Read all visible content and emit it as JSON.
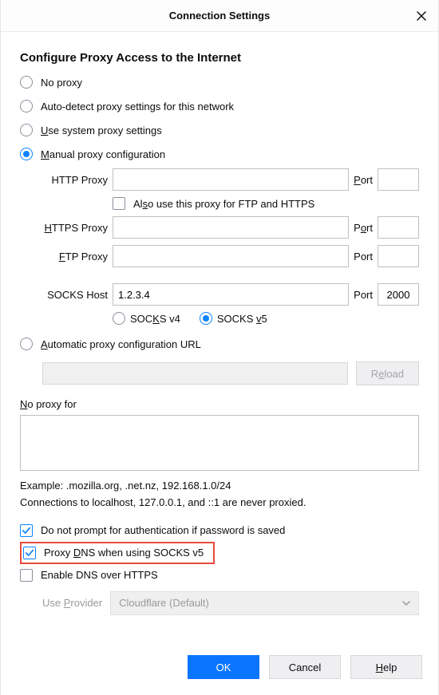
{
  "window": {
    "title": "Connection Settings"
  },
  "section_title": "Configure Proxy Access to the Internet",
  "proxy_mode": {
    "none": "No proxy",
    "auto_detect": "Auto-detect proxy settings for this network",
    "system_pre": "",
    "system_u": "U",
    "system_post": "se system proxy settings",
    "manual_u": "M",
    "manual_post": "anual proxy configuration",
    "pac_u": "A",
    "pac_post": "utomatic proxy configuration URL"
  },
  "fields": {
    "http_proxy": {
      "label": "HTTP Proxy",
      "value": "",
      "port_label_u": "P",
      "port_label_post": "ort",
      "port": ""
    },
    "also_ftp_https": {
      "prefix": "Al",
      "u": "s",
      "suffix": "o use this proxy for FTP and HTTPS"
    },
    "https_proxy": {
      "u": "H",
      "post": "TTPS Proxy",
      "value": "",
      "port_pre": "P",
      "port_u": "o",
      "port_post": "rt",
      "port": ""
    },
    "ftp_proxy": {
      "u": "F",
      "post": "TP Proxy",
      "value": "",
      "port_label": "Port",
      "port": ""
    },
    "socks_host": {
      "label": "SOCKS Host",
      "value": "1.2.3.4",
      "port_label": "Port",
      "port": "2000"
    },
    "socks_version": {
      "v4_pre": "SOC",
      "v4_u": "K",
      "v4_post": "S v4",
      "v5_pre": "SOCKS ",
      "v5_u": "v",
      "v5_post": "5"
    },
    "pac_url": {
      "value": "",
      "reload_pre": "R",
      "reload_u": "e",
      "reload_post": "load"
    }
  },
  "no_proxy": {
    "label_u": "N",
    "label_post": "o proxy for",
    "value": ""
  },
  "hints": {
    "example": "Example: .mozilla.org, .net.nz, 192.168.1.0/24",
    "local": "Connections to localhost, 127.0.0.1, and ::1 are never proxied."
  },
  "checks": {
    "no_prompt": "Do not prompt for authentication if password is saved",
    "proxy_dns_pre": "Proxy ",
    "proxy_dns_u": "D",
    "proxy_dns_post": "NS when using SOCKS v5",
    "doh": "Enable DNS over HTTPS"
  },
  "provider": {
    "label_pre": "Use ",
    "label_u": "P",
    "label_post": "rovider",
    "value": "Cloudflare (Default)"
  },
  "buttons": {
    "ok": "OK",
    "cancel": "Cancel",
    "help_u": "H",
    "help_post": "elp"
  }
}
